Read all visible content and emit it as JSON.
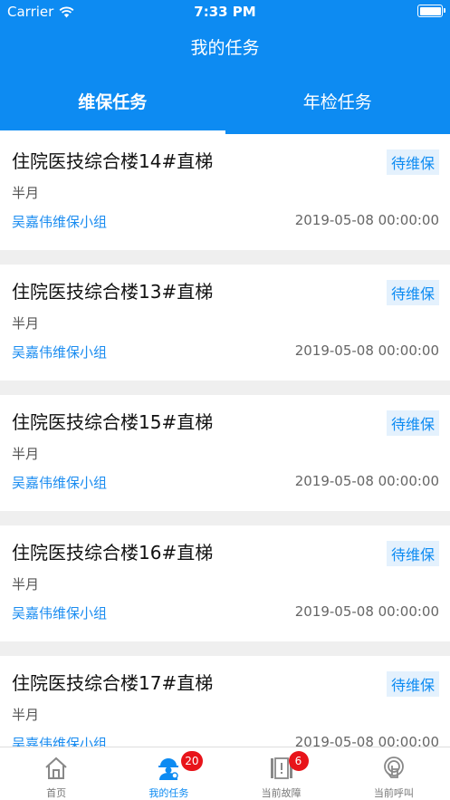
{
  "status_bar": {
    "carrier": "Carrier",
    "time": "7:33 PM"
  },
  "nav": {
    "title": "我的任务"
  },
  "tabs": [
    {
      "label": "维保任务",
      "active": true
    },
    {
      "label": "年检任务",
      "active": false
    }
  ],
  "tasks": [
    {
      "name": "住院医技综合楼14#直梯",
      "status": "待维保",
      "period": "半月",
      "team": "吴嘉伟维保小组",
      "date": "2019-05-08 00:00:00"
    },
    {
      "name": "住院医技综合楼13#直梯",
      "status": "待维保",
      "period": "半月",
      "team": "吴嘉伟维保小组",
      "date": "2019-05-08 00:00:00"
    },
    {
      "name": "住院医技综合楼15#直梯",
      "status": "待维保",
      "period": "半月",
      "team": "吴嘉伟维保小组",
      "date": "2019-05-08 00:00:00"
    },
    {
      "name": "住院医技综合楼16#直梯",
      "status": "待维保",
      "period": "半月",
      "team": "吴嘉伟维保小组",
      "date": "2019-05-08 00:00:00"
    },
    {
      "name": "住院医技综合楼17#直梯",
      "status": "待维保",
      "period": "半月",
      "team": "吴嘉伟维保小组",
      "date": "2019-05-08 00:00:00"
    }
  ],
  "tabbar": [
    {
      "label": "首页",
      "icon": "home-icon",
      "active": false,
      "badge": ""
    },
    {
      "label": "我的任务",
      "icon": "worker-icon",
      "active": true,
      "badge": "20"
    },
    {
      "label": "当前故障",
      "icon": "fault-icon",
      "active": false,
      "badge": "6"
    },
    {
      "label": "当前呼叫",
      "icon": "call-icon",
      "active": false,
      "badge": ""
    }
  ],
  "colors": {
    "primary": "#0d8bf2",
    "badge_red": "#e8141a",
    "background": "#efefef"
  }
}
